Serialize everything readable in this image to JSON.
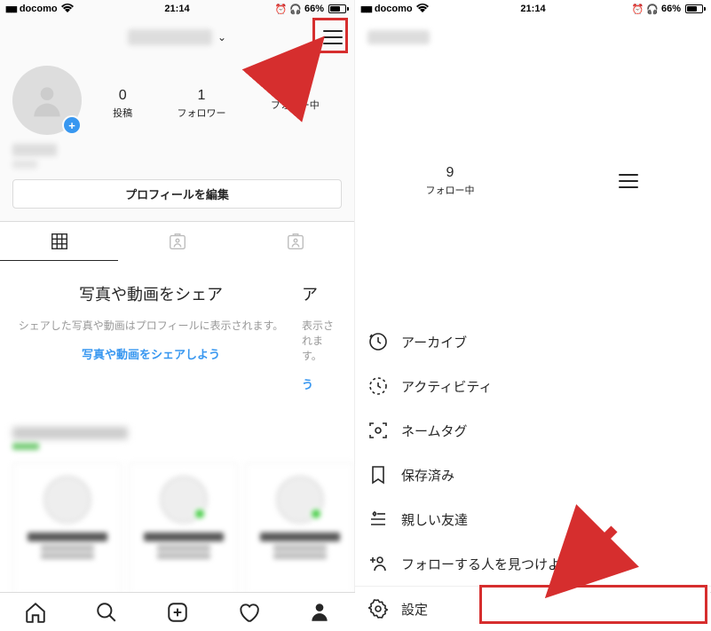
{
  "status": {
    "carrier": "docomo",
    "time": "21:14",
    "battery": "66%"
  },
  "left": {
    "stats": [
      {
        "num": "0",
        "label": "投稿"
      },
      {
        "num": "1",
        "label": "フォロワー"
      },
      {
        "num": "",
        "label": "フォロー中"
      },
      {
        "num": "9",
        "label": "フォロー中"
      }
    ],
    "edit_profile": "プロフィールを編集",
    "share": {
      "title": "写真や動画をシェア",
      "desc": "シェアした写真や動画はプロフィールに表示されます。",
      "cta": "写真や動画をシェアしよう",
      "clip_title": "ア",
      "clip_desc": "表示されます。",
      "clip_cta": "う"
    }
  },
  "menu": {
    "archive": "アーカイブ",
    "activity": "アクティビティ",
    "nametag": "ネームタグ",
    "saved": "保存済み",
    "close_friends": "親しい友達",
    "discover": "フォローする人を見つけよう",
    "settings": "設定"
  }
}
